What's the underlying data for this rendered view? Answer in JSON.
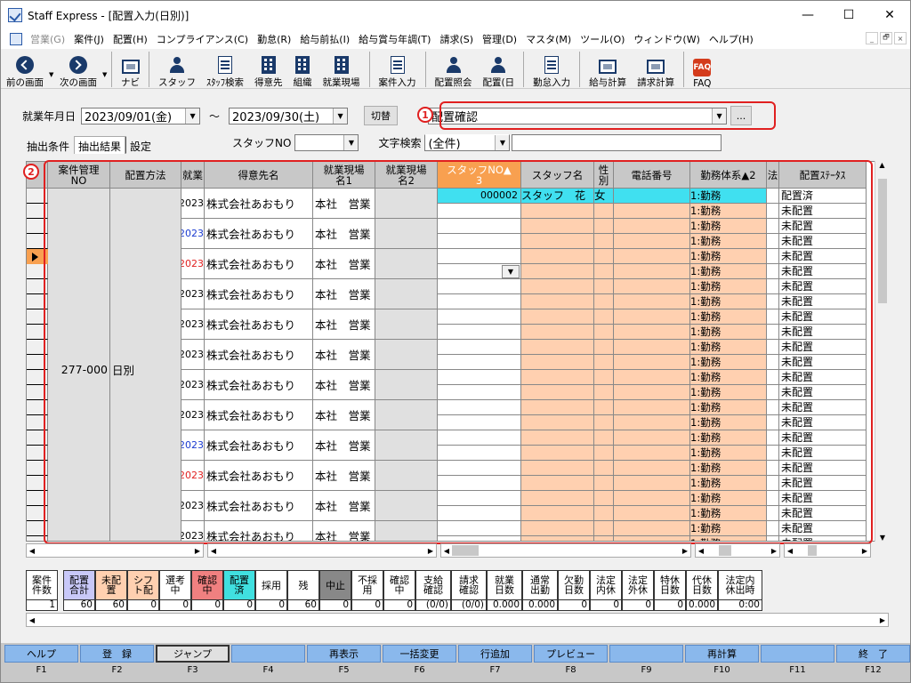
{
  "window": {
    "title": "Staff Express - [配置入力(日別)]",
    "min": "—",
    "max": "☐",
    "close": "✕"
  },
  "menu": [
    {
      "l": "営業(G)",
      "dis": true
    },
    {
      "l": "案件(J)"
    },
    {
      "l": "配置(H)"
    },
    {
      "l": "コンプライアンス(C)"
    },
    {
      "l": "勤怠(R)"
    },
    {
      "l": "給与前払(I)"
    },
    {
      "l": "給与賞与年調(T)"
    },
    {
      "l": "請求(S)"
    },
    {
      "l": "管理(D)"
    },
    {
      "l": "マスタ(M)"
    },
    {
      "l": "ツール(O)"
    },
    {
      "l": "ウィンドウ(W)"
    },
    {
      "l": "ヘルプ(H)"
    }
  ],
  "mdi": [
    "_",
    "🗗",
    "×"
  ],
  "toolbar": [
    {
      "l": "前の画面",
      "ic": "arrow back",
      "dd": true,
      "name": "back-button"
    },
    {
      "l": "次の画面",
      "ic": "arrow fwd",
      "dd": true,
      "name": "forward-button"
    },
    {
      "sep": true
    },
    {
      "l": "ナビ",
      "ic": "monitor",
      "name": "navi-button"
    },
    {
      "sep": true
    },
    {
      "l": "スタッフ",
      "ic": "ppl",
      "name": "staff-button"
    },
    {
      "l": "ｽﾀｯﾌ検索",
      "ic": "doc",
      "name": "staff-search-button"
    },
    {
      "l": "得意先",
      "ic": "build",
      "name": "customer-button"
    },
    {
      "l": "組織",
      "ic": "build",
      "name": "organization-button"
    },
    {
      "l": "就業現場",
      "ic": "build",
      "name": "worksite-button"
    },
    {
      "sep": true
    },
    {
      "l": "案件入力",
      "ic": "doc",
      "name": "case-input-button"
    },
    {
      "sep": true
    },
    {
      "l": "配置照会",
      "ic": "ppl",
      "name": "assignment-inquiry-button"
    },
    {
      "l": "配置(日",
      "ic": "ppl",
      "name": "assignment-daily-button"
    },
    {
      "sep": true
    },
    {
      "l": "勤怠入力",
      "ic": "doc",
      "name": "attendance-input-button"
    },
    {
      "sep": true
    },
    {
      "l": "給与計算",
      "ic": "monitor",
      "name": "payroll-calc-button"
    },
    {
      "l": "請求計算",
      "ic": "monitor",
      "name": "billing-calc-button"
    },
    {
      "sep": true
    },
    {
      "l": "FAQ",
      "ic": "faq",
      "t": "FAQ",
      "name": "faq-button"
    }
  ],
  "filter": {
    "label": "就業年月日",
    "from": "2023/09/01(金)",
    "tilde": "～",
    "to": "2023/09/30(土)",
    "switch": "切替",
    "view": "配置確認",
    "dots": "..."
  },
  "badges": {
    "one": "1",
    "two": "2"
  },
  "tabs": [
    "抽出条件",
    "抽出結果",
    "設定"
  ],
  "staffno": {
    "label": "スタッフNO",
    "value": ""
  },
  "textsearch": {
    "label": "文字検索",
    "value": "(全件)"
  },
  "headers": [
    "案件管理\nNO",
    "配置方法",
    "就業",
    "得意先名",
    "就業現場\n名1",
    "就業現場\n名2",
    "スタッフNO▲\n3",
    "スタッフ名",
    "性\n別",
    "電話番号",
    "勤務体系▲2",
    "法",
    "配置ｽﾃｰﾀｽ"
  ],
  "grid": {
    "case_no": "277-000",
    "method": "日別",
    "rows": [
      {
        "d": "2023",
        "dc": "#000",
        "cust": "株式会社あおもり",
        "site": "本社　営業",
        "staff": [
          {
            "no": "000002",
            "name": "スタッフ　花",
            "sex": "女",
            "st": "配置済"
          },
          {
            "st": "未配置"
          }
        ]
      },
      {
        "d": "2023",
        "dc": "#1a3ad0",
        "cust": "株式会社あおもり",
        "site": "本社　営業",
        "staff": [
          {
            "st": "未配置"
          },
          {
            "st": "未配置"
          }
        ]
      },
      {
        "d": "2023",
        "dc": "#e02020",
        "cust": "株式会社あおもり",
        "site": "本社　営業",
        "staff": [
          {
            "st": "未配置"
          },
          {
            "st": "未配置"
          }
        ]
      },
      {
        "d": "2023",
        "dc": "#000",
        "cust": "株式会社あおもり",
        "site": "本社　営業",
        "staff": [
          {
            "st": "未配置"
          },
          {
            "st": "未配置"
          }
        ]
      },
      {
        "d": "2023",
        "dc": "#000",
        "cust": "株式会社あおもり",
        "site": "本社　営業",
        "staff": [
          {
            "st": "未配置"
          },
          {
            "st": "未配置"
          }
        ]
      },
      {
        "d": "2023",
        "dc": "#000",
        "cust": "株式会社あおもり",
        "site": "本社　営業",
        "staff": [
          {
            "st": "未配置"
          },
          {
            "st": "未配置"
          }
        ]
      },
      {
        "d": "2023",
        "dc": "#000",
        "cust": "株式会社あおもり",
        "site": "本社　営業",
        "staff": [
          {
            "st": "未配置"
          },
          {
            "st": "未配置"
          }
        ]
      },
      {
        "d": "2023",
        "dc": "#000",
        "cust": "株式会社あおもり",
        "site": "本社　営業",
        "staff": [
          {
            "st": "未配置"
          },
          {
            "st": "未配置"
          }
        ]
      },
      {
        "d": "2023",
        "dc": "#1a3ad0",
        "cust": "株式会社あおもり",
        "site": "本社　営業",
        "staff": [
          {
            "st": "未配置"
          },
          {
            "st": "未配置"
          }
        ]
      },
      {
        "d": "2023",
        "dc": "#e02020",
        "cust": "株式会社あおもり",
        "site": "本社　営業",
        "staff": [
          {
            "st": "未配置"
          },
          {
            "st": "未配置"
          }
        ]
      },
      {
        "d": "2023",
        "dc": "#000",
        "cust": "株式会社あおもり",
        "site": "本社　営業",
        "staff": [
          {
            "st": "未配置"
          },
          {
            "st": "未配置"
          }
        ]
      },
      {
        "d": "2023",
        "dc": "#000",
        "cust": "株式会社あおもり",
        "site": "本社　営業",
        "staff": [
          {
            "st": "未配置"
          },
          {
            "st": "未配置"
          }
        ]
      }
    ],
    "shift": "1:勤務"
  },
  "summary": [
    {
      "h": "案件\n件数",
      "v": "1",
      "bg": "#fff"
    },
    {
      "h": "配置\n合計",
      "v": "60",
      "bg": "#c8c8f8"
    },
    {
      "h": "未配\n置",
      "v": "60",
      "bg": "#ffd0b0"
    },
    {
      "h": "シフ\nト配",
      "v": "0",
      "bg": "#ffd0b0"
    },
    {
      "h": "選考\n中",
      "v": "0",
      "bg": "#fff"
    },
    {
      "h": "確認\n中",
      "v": "0",
      "bg": "#f08080"
    },
    {
      "h": "配置\n済",
      "v": "0",
      "bg": "#40e0e0"
    },
    {
      "h": "採用",
      "v": "0",
      "bg": "#fff"
    },
    {
      "h": "残",
      "v": "60",
      "bg": "#fff"
    },
    {
      "h": "中止",
      "v": "0",
      "bg": "#888"
    },
    {
      "h": "不採\n用",
      "v": "0",
      "bg": "#fff"
    },
    {
      "h": "確認\n中",
      "v": "0",
      "bg": "#fff"
    },
    {
      "h": "支給\n確認",
      "v": "(0/0)",
      "bg": "#fff"
    },
    {
      "h": "請求\n確認",
      "v": "(0/0)",
      "bg": "#fff"
    },
    {
      "h": "就業\n日数",
      "v": "0.000",
      "bg": "#fff"
    },
    {
      "h": "通常\n出勤",
      "v": "0.000",
      "bg": "#fff"
    },
    {
      "h": "欠勤\n日数",
      "v": "0",
      "bg": "#fff"
    },
    {
      "h": "法定\n内休",
      "v": "0",
      "bg": "#fff"
    },
    {
      "h": "法定\n外休",
      "v": "0",
      "bg": "#fff"
    },
    {
      "h": "特休\n日数",
      "v": "0",
      "bg": "#fff"
    },
    {
      "h": "代休\n日数",
      "v": "0.000",
      "bg": "#fff"
    },
    {
      "h": "法定内\n休出時",
      "v": "0:00",
      "bg": "#fff"
    }
  ],
  "fkeys": [
    {
      "l": "ヘルプ",
      "n": "F1"
    },
    {
      "l": "登　録",
      "n": "F2"
    },
    {
      "l": "ジャンプ",
      "n": "F3",
      "act": true
    },
    {
      "l": "",
      "n": "F4"
    },
    {
      "l": "再表示",
      "n": "F5"
    },
    {
      "l": "一括変更",
      "n": "F6"
    },
    {
      "l": "行追加",
      "n": "F7"
    },
    {
      "l": "プレビュー",
      "n": "F8"
    },
    {
      "l": "",
      "n": "F9"
    },
    {
      "l": "再計算",
      "n": "F10"
    },
    {
      "l": "",
      "n": "F11"
    },
    {
      "l": "終　了",
      "n": "F12"
    }
  ]
}
